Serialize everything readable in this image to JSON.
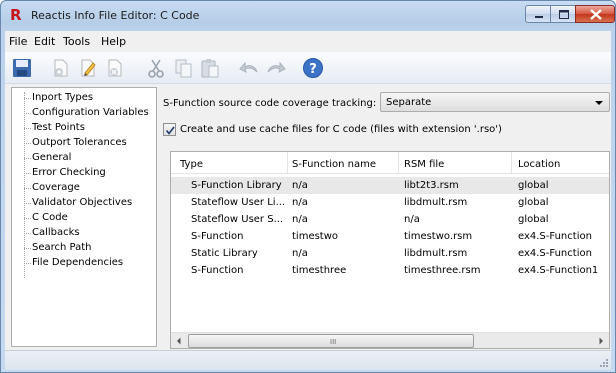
{
  "window": {
    "title": "Reactis Info File Editor: C Code",
    "logo_letter": "R",
    "logo_color": "#c8161d"
  },
  "menu": [
    "File",
    "Edit",
    "Tools",
    "Help"
  ],
  "toolbar": {
    "icons": [
      "save-icon",
      "new-document-icon",
      "edit-document-icon",
      "delete-document-icon",
      "cut-icon",
      "copy-icon",
      "paste-icon",
      "undo-icon",
      "redo-icon",
      "help-icon"
    ]
  },
  "tree": {
    "items": [
      "Inport Types",
      "Configuration Variables",
      "Test Points",
      "Outport Tolerances",
      "General",
      "Error Checking",
      "Coverage",
      "Validator Objectives",
      "C Code",
      "Callbacks",
      "Search Path",
      "File Dependencies"
    ],
    "selected": "C Code"
  },
  "coverage": {
    "label": "S-Function source code coverage tracking:",
    "value": "Separate"
  },
  "cache": {
    "checked": true,
    "label": "Create and use cache files for C code (files with extension '.rso')"
  },
  "table": {
    "columns": [
      "Type",
      "S-Function name",
      "RSM file",
      "Location"
    ],
    "rows": [
      [
        "S-Function Library",
        "n/a",
        "libt2t3.rsm",
        "global"
      ],
      [
        "Stateflow User Li...",
        "n/a",
        "libdmult.rsm",
        "global"
      ],
      [
        "Stateflow User S...",
        "n/a",
        "n/a",
        "global"
      ],
      [
        "S-Function",
        "timestwo",
        "timestwo.rsm",
        "ex4.S-Function"
      ],
      [
        "Static Library",
        "n/a",
        "libdmult.rsm",
        "ex4.S-Function"
      ],
      [
        "S-Function",
        "timesthree",
        "timesthree.rsm",
        "ex4.S-Function1"
      ]
    ],
    "selected_row": 0,
    "scroll_grip": "III"
  }
}
